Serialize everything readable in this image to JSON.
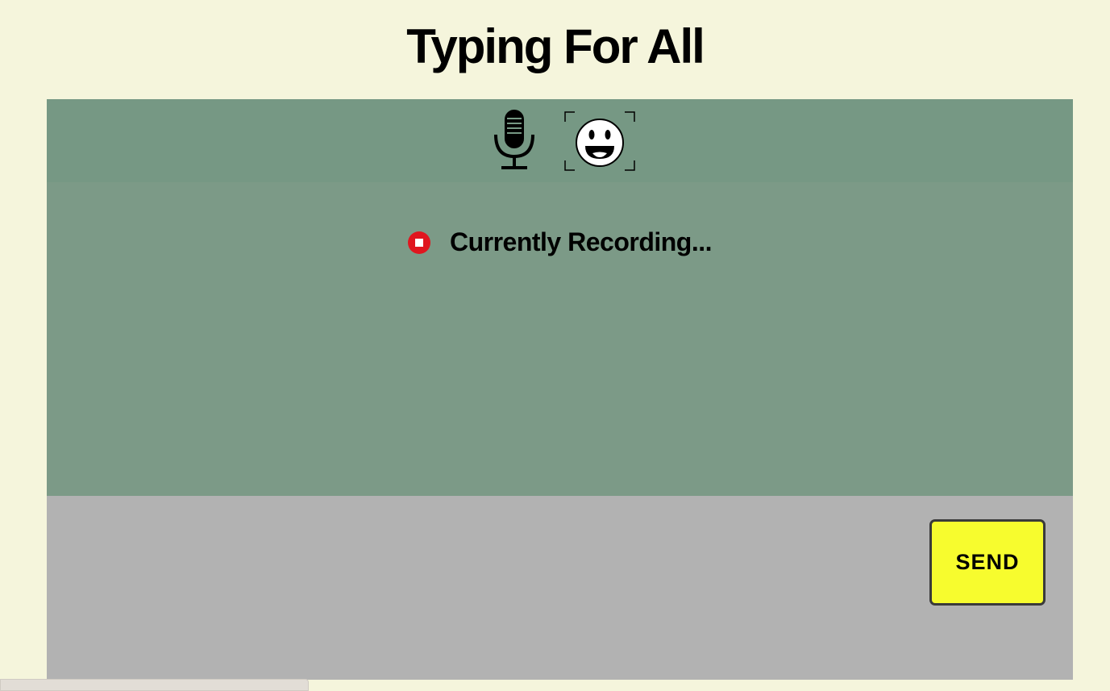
{
  "header": {
    "title": "Typing For All"
  },
  "toolbar": {
    "buttons": [
      {
        "id": "mic",
        "icon": "microphone-icon"
      },
      {
        "id": "face",
        "icon": "face-scan-icon"
      }
    ]
  },
  "transcript": {
    "status_text": "Currently Recording...",
    "status_icon": "record-stop-icon",
    "status_color": "#e0161f"
  },
  "composer": {
    "send_label": "SEND"
  },
  "colors": {
    "background": "#f5f5dc",
    "toolbar": "#769884",
    "transcript": "#7c9a87",
    "composer": "#b2b2b2",
    "send_button": "#f7fc2e"
  }
}
